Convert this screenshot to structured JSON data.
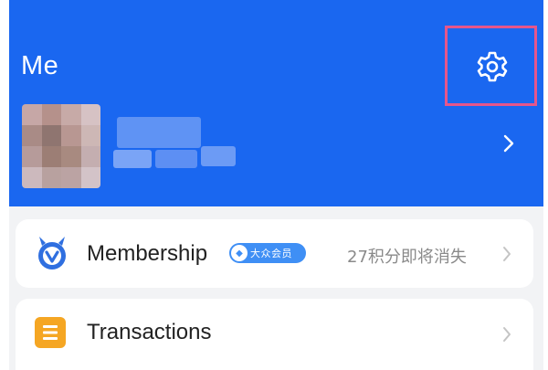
{
  "header": {
    "title": "Me",
    "settings_icon": "gear-icon",
    "background_color": "#1a67f0",
    "highlight_color": "#e5568c"
  },
  "profile": {
    "avatar_icon": "blurred-avatar",
    "chevron_icon": "chevron-right-icon"
  },
  "menu": {
    "items": [
      {
        "label": "Membership",
        "icon": "membership-medal-icon",
        "badge": "大众会员",
        "detail": "27积分即将消失",
        "chevron_icon": "chevron-right-icon"
      },
      {
        "label": "Transactions",
        "icon": "transactions-list-icon",
        "chevron_icon": "chevron-right-icon"
      }
    ]
  },
  "colors": {
    "accent_blue": "#1a67f0",
    "badge_blue": "#3f8ff5",
    "transactions_icon": "#f5a623",
    "page_background": "#f2f3f5"
  }
}
